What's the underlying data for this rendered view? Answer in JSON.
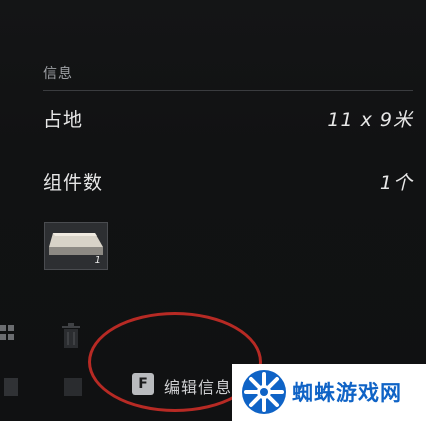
{
  "info": {
    "section_title": "信息"
  },
  "rows": [
    {
      "label": "占地",
      "value": "11 x 9米"
    },
    {
      "label": "组件数",
      "value": "1个"
    }
  ],
  "component_item": {
    "count": "1",
    "icon": "stone-slab-thumbnail"
  },
  "action": {
    "key": "F",
    "label": "编辑信息"
  },
  "annotation": {
    "color": "#b72a24"
  },
  "watermark": {
    "text": "蜘蛛游戏网",
    "color": "#0f63c6"
  }
}
